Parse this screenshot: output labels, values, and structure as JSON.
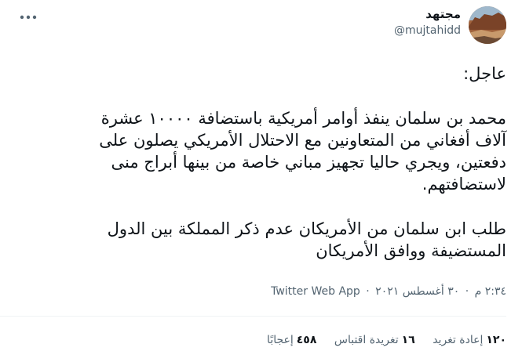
{
  "user": {
    "display_name": "مجتهد",
    "username": "@mujtahidd",
    "avatar_icon": "desert-landscape-avatar"
  },
  "tweet": {
    "lines": [
      "عاجل:",
      "محمد بن سلمان ينفذ أوامر أمريكية باستضافة ١٠٠٠٠ عشرة",
      "آلاف أفغاني من المتعاونين مع الاحتلال الأمريكي يصلون على",
      "دفعتين، ويجري حاليا تجهيز مباني خاصة من بينها أبراج منى",
      "لاستضافتهم.",
      "طلب ابن سلمان من الأمريكان عدم ذكر المملكة بين الدول",
      "المستضيفة ووافق الأمريكان"
    ]
  },
  "meta": {
    "time": "٢:٣٤ م",
    "date": "٣٠ أغسطس ٢٠٢١",
    "separator": "·",
    "source": "Twitter Web App"
  },
  "stats": {
    "retweets": {
      "count": "١٢٠",
      "label": "إعادة تغريد"
    },
    "quotes": {
      "count": "١٦",
      "label": "تغريدة اقتباس"
    },
    "likes": {
      "count": "٤٥٨",
      "label": "إعجابًا"
    }
  },
  "colors": {
    "text": "#0f1419",
    "secondary": "#536471",
    "divider": "#eff3f4",
    "background": "#ffffff"
  }
}
